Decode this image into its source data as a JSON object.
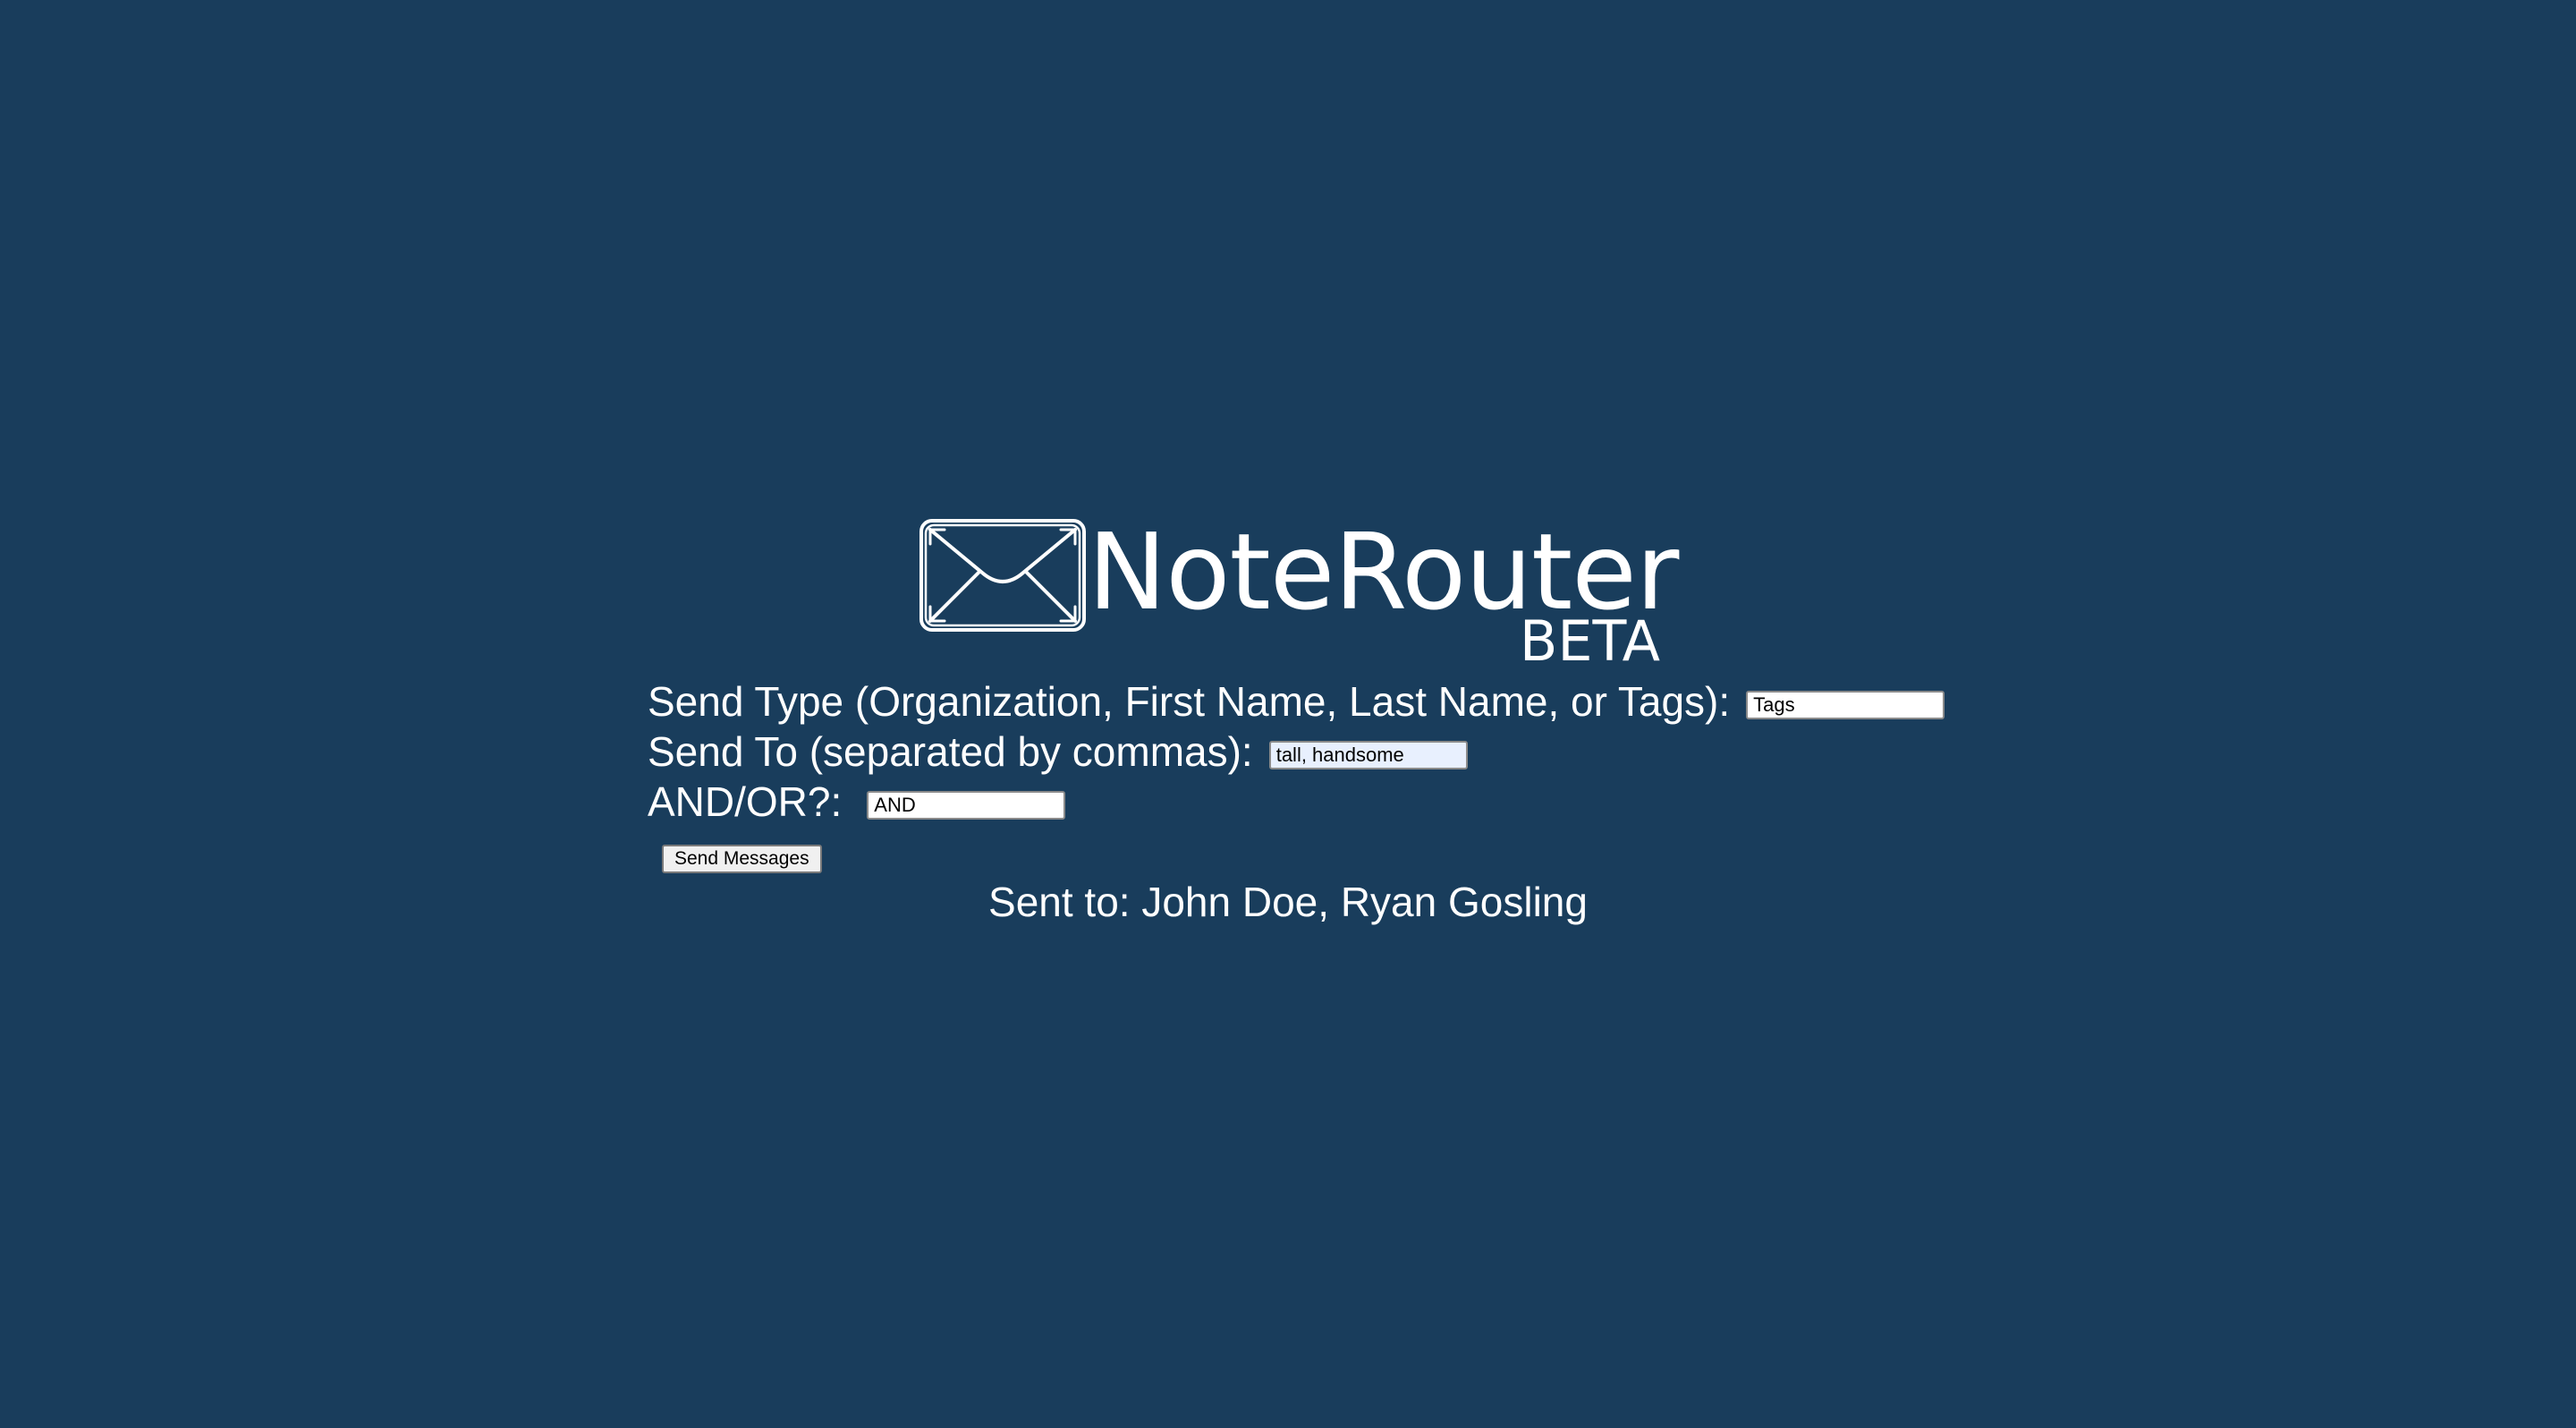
{
  "app": {
    "logo_text": "NoteRouter",
    "logo_badge": "BETA",
    "logo_icon": "envelope-icon"
  },
  "form": {
    "send_type": {
      "label": "Send Type (Organization, First Name, Last Name, or Tags):",
      "value": "Tags"
    },
    "send_to": {
      "label": "Send To (separated by commas):",
      "value": "tall, handsome"
    },
    "and_or": {
      "label": "AND/OR?:",
      "value": "AND"
    },
    "submit_label": "Send Messages"
  },
  "status": {
    "sent_to": "Sent to: John Doe, Ryan Gosling"
  },
  "colors": {
    "background": "#193d5c",
    "text": "#ffffff"
  }
}
